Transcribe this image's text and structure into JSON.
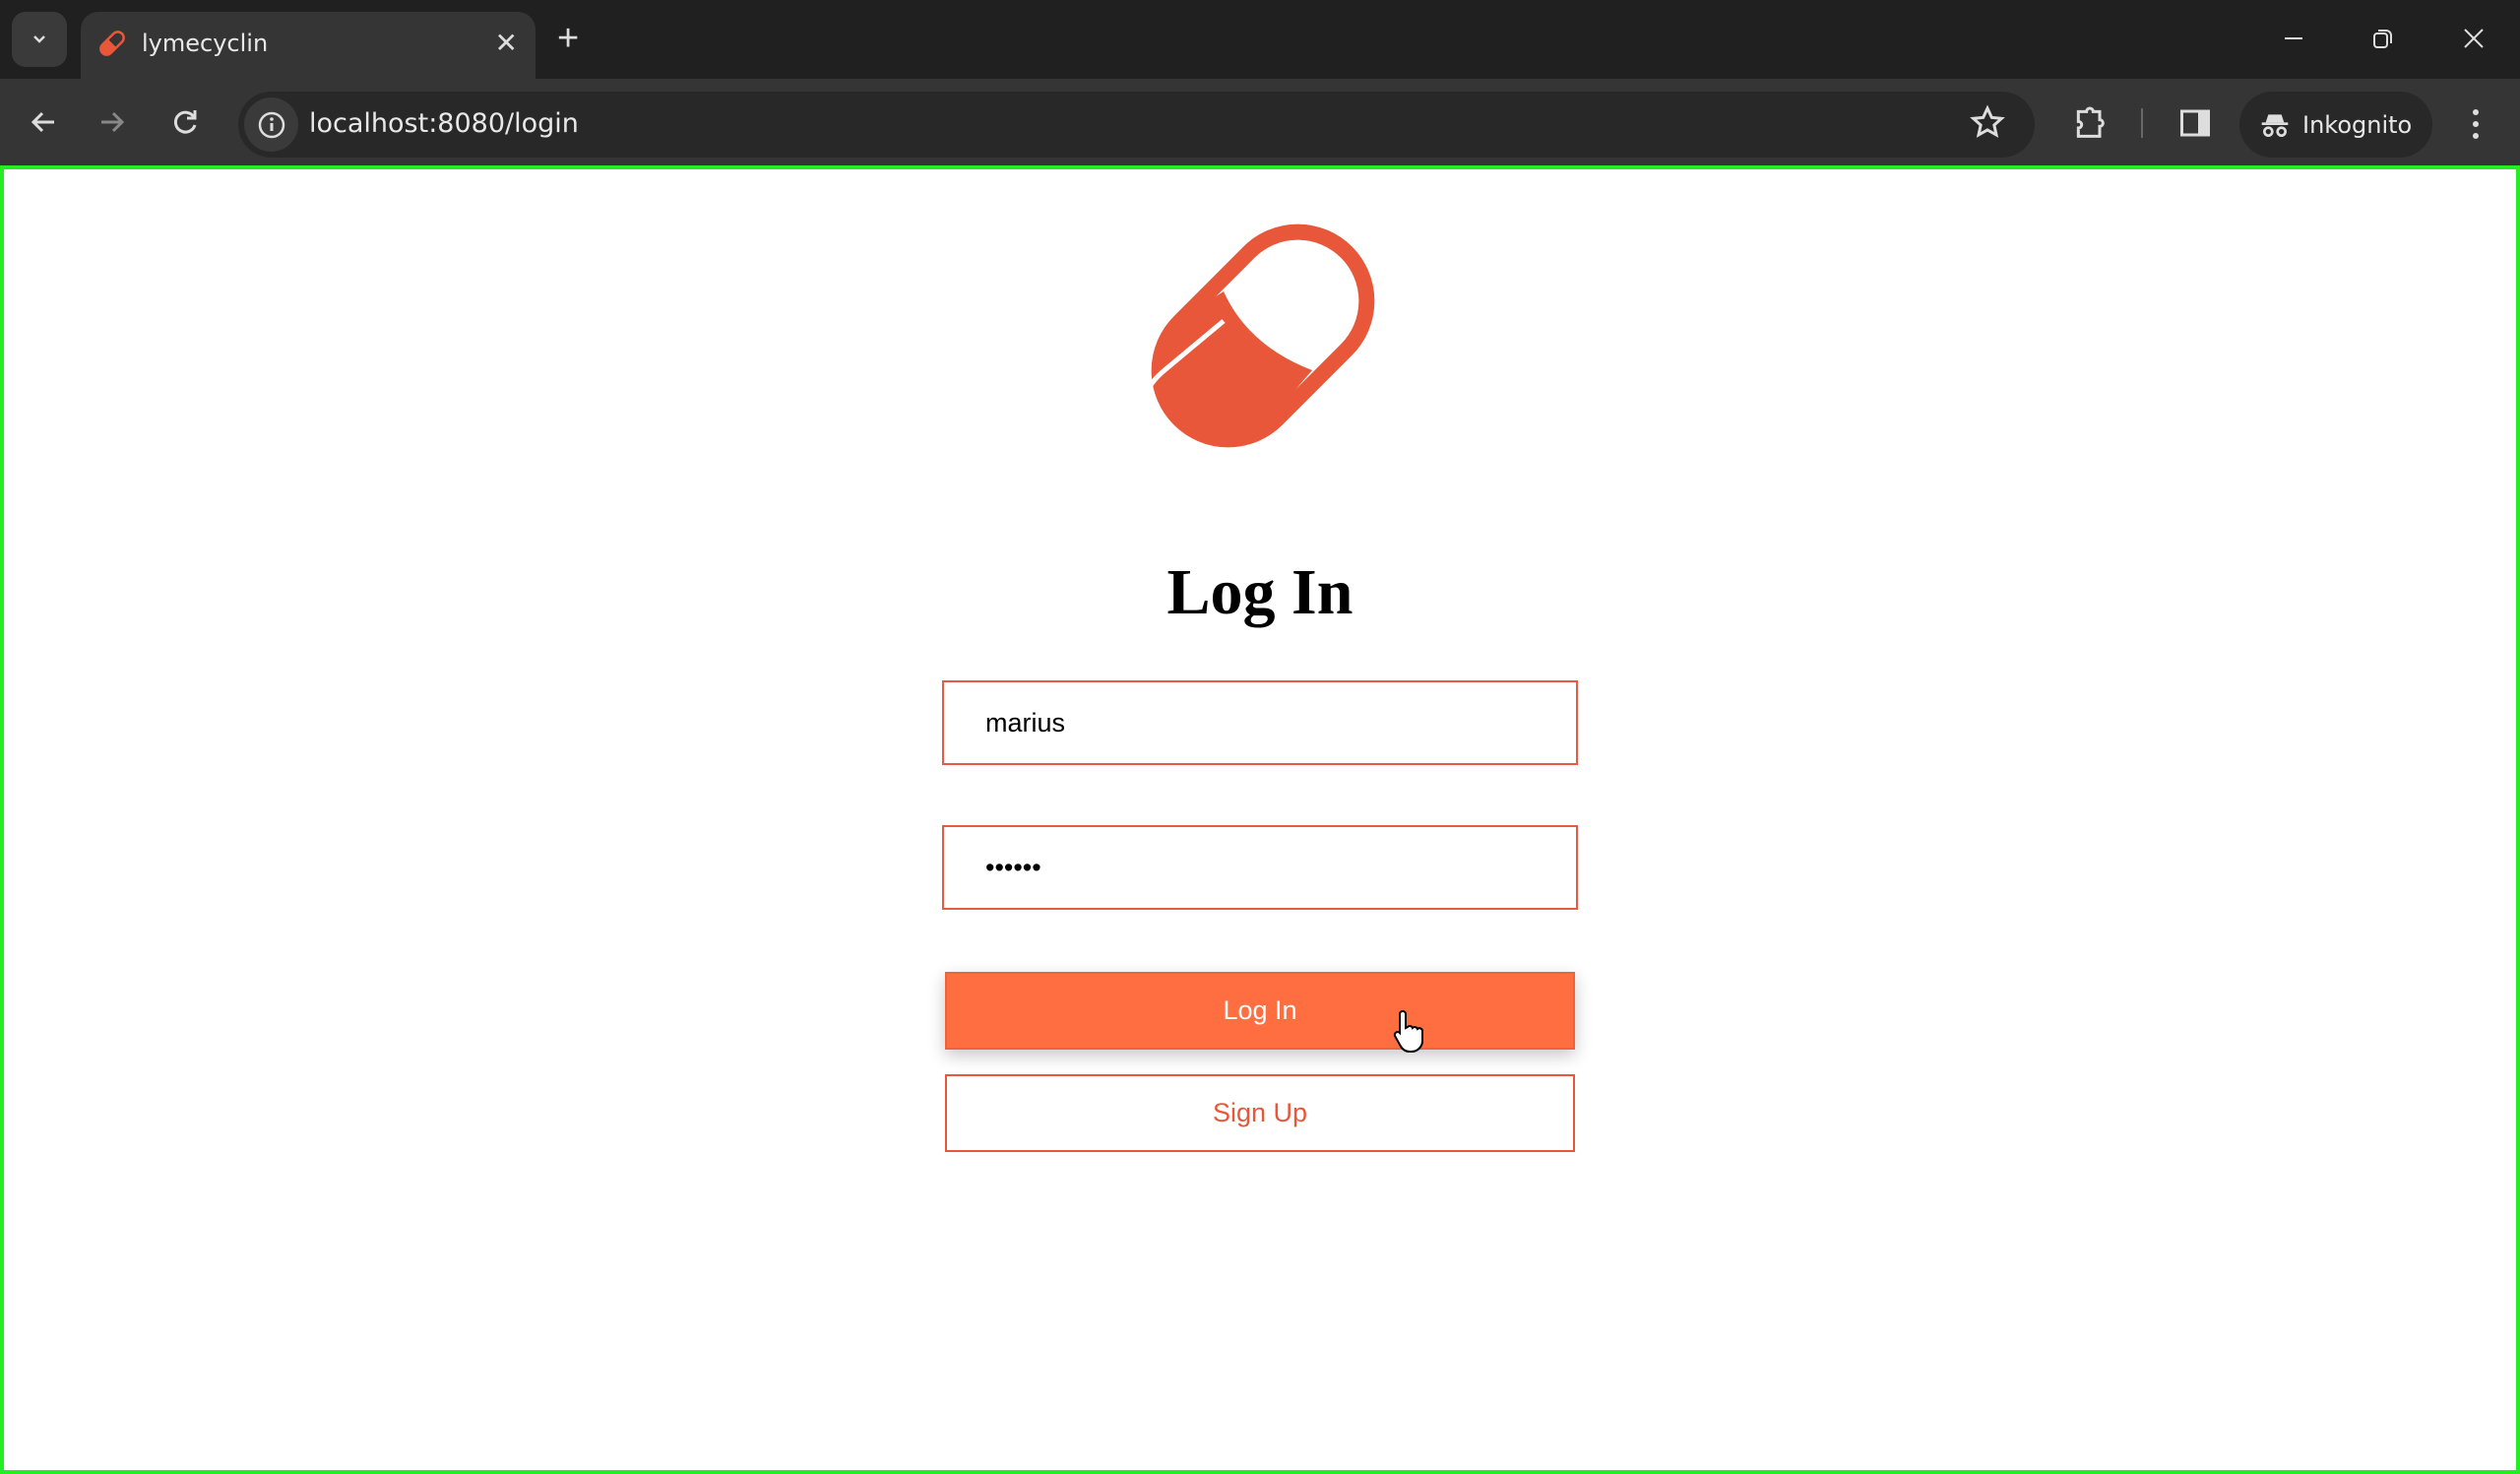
{
  "browser": {
    "tab_title": "lymecyclin",
    "url": "localhost:8080/login",
    "profile_label": "Inkognito",
    "close_tab_glyph": "✕",
    "new_tab_glyph": "+"
  },
  "page": {
    "heading": "Log In",
    "username_value": "marius",
    "password_value": "••••••",
    "login_label": "Log In",
    "signup_label": "Sign Up"
  },
  "colors": {
    "accent": "#ff6e40",
    "brand": "#e8573a",
    "frame": "#22ee22"
  }
}
